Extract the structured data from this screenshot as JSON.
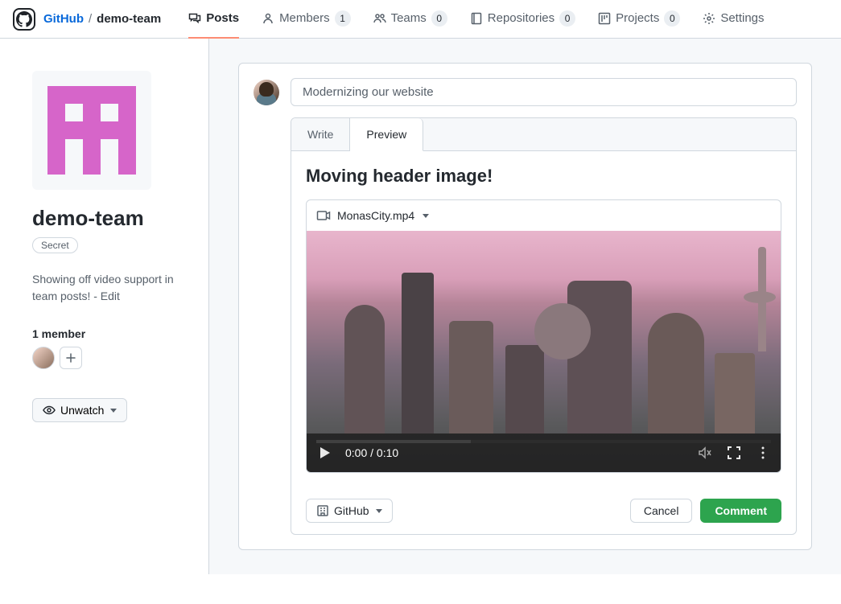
{
  "header": {
    "breadcrumb_org": "GitHub",
    "breadcrumb_team": "demo-team"
  },
  "tabs": [
    {
      "label": "Posts",
      "count": null,
      "active": true
    },
    {
      "label": "Members",
      "count": "1",
      "active": false
    },
    {
      "label": "Teams",
      "count": "0",
      "active": false
    },
    {
      "label": "Repositories",
      "count": "0",
      "active": false
    },
    {
      "label": "Projects",
      "count": "0",
      "active": false
    },
    {
      "label": "Settings",
      "count": null,
      "active": false
    }
  ],
  "sidebar": {
    "team_name": "demo-team",
    "visibility_badge": "Secret",
    "description": "Showing off video support in team posts! - Edit",
    "members_label": "1 member",
    "unwatch_label": "Unwatch"
  },
  "post": {
    "title_placeholder": "Modernizing our website",
    "editor_tabs": {
      "write": "Write",
      "preview": "Preview"
    },
    "preview_heading": "Moving header image!",
    "video_filename": "MonasCity.mp4",
    "video_time": "0:00 / 0:10",
    "org_button": "GitHub",
    "cancel": "Cancel",
    "comment": "Comment"
  }
}
